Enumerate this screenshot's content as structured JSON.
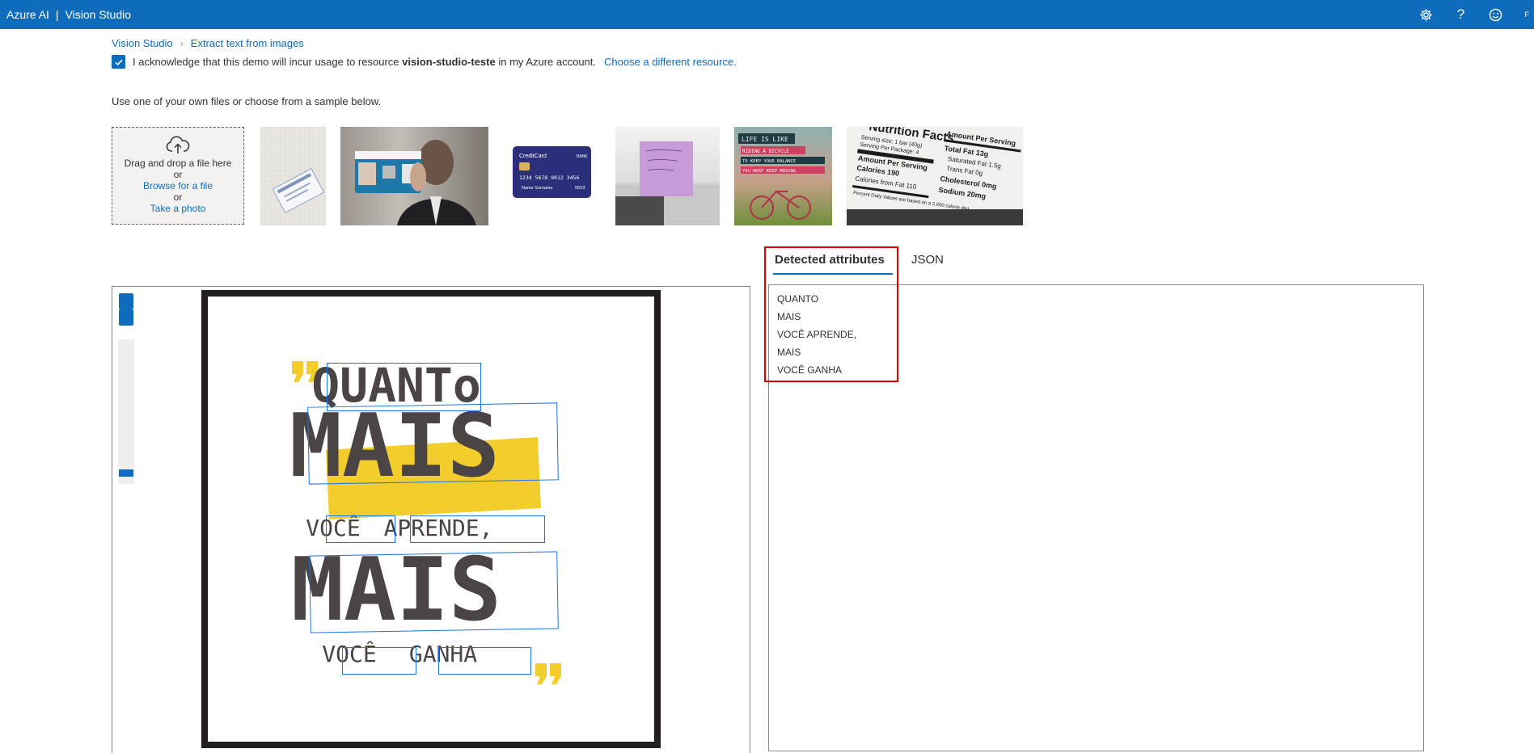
{
  "app": {
    "brand": "Azure AI",
    "product": "Vision Studio",
    "account_initial": "F"
  },
  "topbar_icons": [
    "gear-icon",
    "help-icon",
    "smiley-icon"
  ],
  "breadcrumb": {
    "home": "Vision Studio",
    "current": "Extract text from images"
  },
  "ack": {
    "text_before": "I acknowledge that this demo will incur usage to resource",
    "resource": "vision-studio-teste",
    "text_after": "in my Azure account.",
    "link": "Choose a different resource."
  },
  "instructions": "Use one of your own files or choose from a sample below.",
  "upload": {
    "drag": "Drag and drop a file here",
    "or1": "or",
    "browse": "Browse for a file",
    "or2": "or",
    "photo": "Take a photo"
  },
  "samples": {
    "credit_card": {
      "brand": "CreditCard",
      "bank": "BANK",
      "number": "1234 5678 9012 3456",
      "name": "Name Surname",
      "expiry": "00/23"
    },
    "bike": {
      "l1": "LIFE IS LIKE",
      "l2": "RIDING A BICYCLE",
      "l3": "TO KEEP YOUR BALANCE",
      "l4": "YOU MUST KEEP MOVING"
    },
    "nutrition": {
      "title": "Nutrition Facts",
      "serving": "Serving size: 1 bar (40g)",
      "per_package": "Serving Per Package: 4",
      "amount": "Amount Per Serving",
      "calories": "Calories 190",
      "fat_cal": "Calories from Fat 110",
      "total_fat": "Total Fat 13g",
      "sat_fat": "Saturated Fat 1.5g",
      "trans_fat": "Trans Fat 0g",
      "cholesterol": "Cholesterol 0mg",
      "sodium": "Sodium 20mg",
      "daily": "Percent Daily Values are based on a 2,000 calorie diet"
    }
  },
  "tabs": {
    "detected": "Detected attributes",
    "json": "JSON"
  },
  "poster": {
    "w1": "QUANTo",
    "w2": "MAIS",
    "w3a": "VOCÊ",
    "w3b": "APRENDE,",
    "w4": "MAIS",
    "w5a": "VOCÊ",
    "w5b": "GANHA"
  },
  "results": [
    "QUANTO",
    "MAIS",
    "VOCÊ APRENDE,",
    "MAIS",
    "VOCÊ GANHA"
  ],
  "colors": {
    "accent": "#0f6cbd",
    "highlight": "#e00000",
    "poster_yellow": "#f2cd2c",
    "bbox": "#1a73e8"
  }
}
